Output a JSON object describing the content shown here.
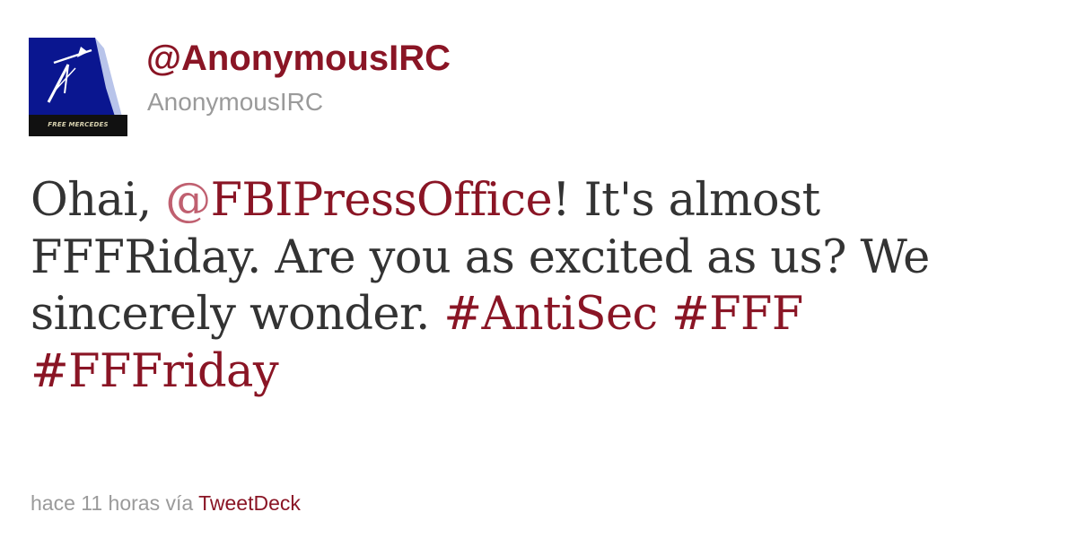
{
  "profile": {
    "screen_name": "@AnonymousIRC",
    "full_name": "AnonymousIRC",
    "avatar_caption": "FREE MERCEDES",
    "avatar_icon": "free-mercedes-logo"
  },
  "tweet": {
    "text_before_mention": "Ohai, ",
    "mention_at": "@",
    "mention_handle": "FBIPressOffice",
    "text_after_mention": "! It's almost FFFRiday. Are you as excited as us? We sincerely wonder. ",
    "hashtags": [
      "#AntiSec",
      "#FFF",
      "#FFFriday"
    ]
  },
  "meta": {
    "time_text": "hace 11 horas vía",
    "source_link": "TweetDeck"
  },
  "colors": {
    "link": "#8a1525",
    "mention_at": "#c06070",
    "text": "#333333",
    "muted": "#9a9a9a",
    "avatar_bg": "#0a1690"
  }
}
